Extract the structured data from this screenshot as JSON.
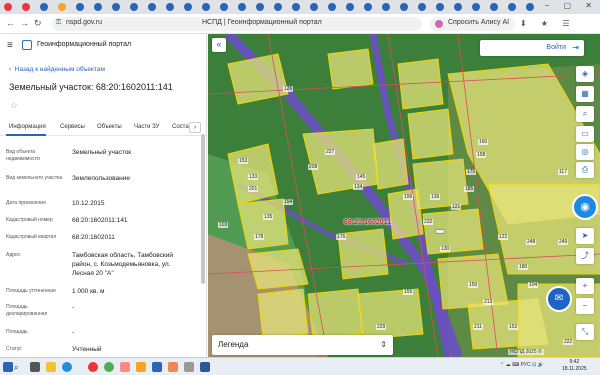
{
  "browser": {
    "url": "nspd.gov.ru",
    "page_title": "НСПД | Геоинформационный портал",
    "alice_label": "Спросить Алису AI"
  },
  "panel": {
    "portal_name": "Геоинформационный портал",
    "back_link": "Назад к найденным объектам",
    "title": "Земельный участок: 68:20:1602011:141",
    "tabs": [
      "Информация",
      "Сервисы",
      "Объекты",
      "Части ЗУ",
      "Соста"
    ],
    "fields": [
      {
        "label": "Вид объекта недвижимости",
        "value": "Земельный участок"
      },
      {
        "label": "Вид земельного участка",
        "value": "Землепользование"
      },
      {
        "label": "Дата присвоения",
        "value": "10.12.2015"
      },
      {
        "label": "Кадастровый номер",
        "value": "68:20:1602011:141"
      },
      {
        "label": "Кадастровый квартал",
        "value": "68:20:1602011"
      },
      {
        "label": "Адрес",
        "value": "Тамбовская область, Тамбовский район, с. Козьмодемьяновка, ул. Лесная 20 \"А\""
      },
      {
        "label": "Площадь уточненная",
        "value": "1 000 кв. м"
      },
      {
        "label": "Площадь декларированная",
        "value": "-"
      },
      {
        "label": "Площадь",
        "value": "-"
      },
      {
        "label": "Статус",
        "value": "Учтенный"
      }
    ]
  },
  "map": {
    "login_label": "Войти",
    "legend_label": "Легенда",
    "cadastral_label": "68:20:1602011",
    "attribution": "НСПД 2025 ©",
    "parcel_labels": [
      "227",
      "208",
      "201",
      "196",
      "136",
      "135",
      "133",
      "134",
      "145",
      "153",
      "154",
      "178",
      "103",
      "176",
      "232",
      "130",
      "170",
      "185",
      "158",
      "160",
      "121",
      "117",
      "122",
      "248",
      "249",
      "180",
      "155",
      "213",
      "211",
      "152",
      "229",
      "150",
      "104",
      "126",
      "222"
    ],
    "colors": {
      "parcel_fill": "#e6e37a",
      "parcel_stroke": "#f2d400",
      "boundary": "#e04b5a",
      "road": "#6a4fc4",
      "forest": "#2a6e2e",
      "accent": "#2b63b8"
    }
  },
  "taskbar": {
    "language": "РУС",
    "time": "9:42",
    "date": "18.11.2025"
  }
}
